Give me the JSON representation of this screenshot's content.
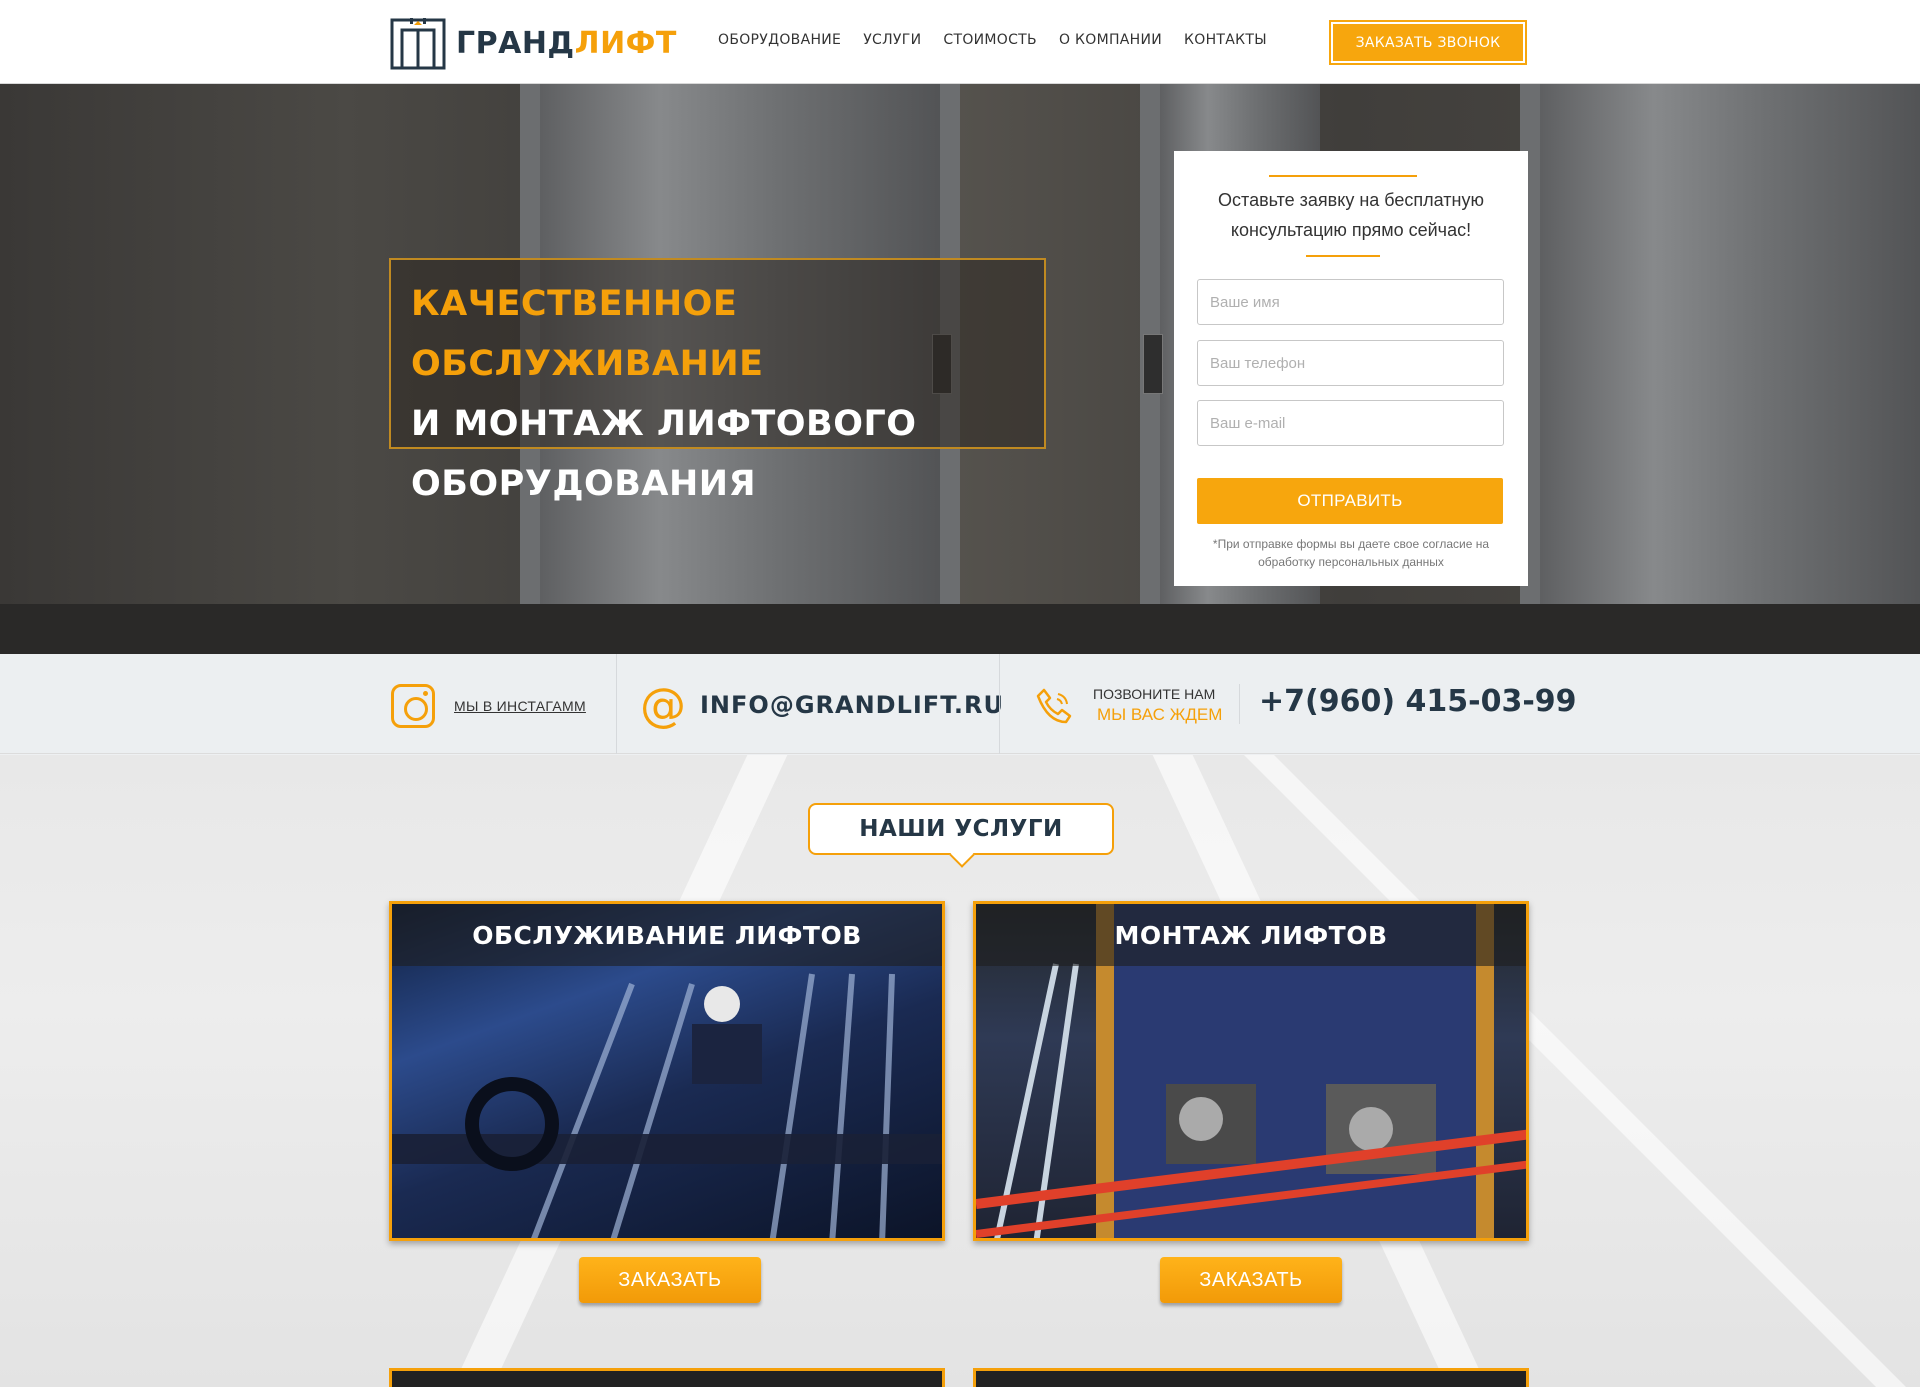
{
  "header": {
    "logo_part1": "ГРАНД",
    "logo_part2": "ЛИФТ",
    "nav": [
      "ОБОРУДОВАНИЕ",
      "УСЛУГИ",
      "СТОИМОСТЬ",
      "О КОМПАНИИ",
      "КОНТАКТЫ"
    ],
    "call_button": "ЗАКАЗАТЬ ЗВОНОК"
  },
  "hero": {
    "line1": "КАЧЕСТВЕННОЕ ОБСЛУЖИВАНИЕ",
    "line2": "И МОНТАЖ ЛИФТОВОГО",
    "line3": "ОБОРУДОВАНИЯ"
  },
  "form": {
    "title": "Оставьте заявку на бесплатную консультацию прямо сейчас!",
    "name_placeholder": "Ваше имя",
    "phone_placeholder": "Ваш телефон",
    "email_placeholder": "Ваш e-mail",
    "submit": "ОТПРАВИТЬ",
    "note": "*При отправке формы вы даете свое согласие на обработку персональных данных"
  },
  "contacts": {
    "instagram": "МЫ В ИНСТАГАММ",
    "email": "INFO@GRANDLIFT.RU",
    "call_label": "ПОЗВОНИТЕ НАМ",
    "call_sub": "МЫ ВАС ЖДЕМ",
    "phone": "+7(960) 415-03-99"
  },
  "services": {
    "title": "НАШИ УСЛУГИ",
    "items": [
      {
        "title": "ОБСЛУЖИВАНИЕ ЛИФТОВ",
        "button": "ЗАКАЗАТЬ"
      },
      {
        "title": "МОНТАЖ ЛИФТОВ",
        "button": "ЗАКАЗАТЬ"
      }
    ]
  },
  "colors": {
    "accent": "#f5a00a",
    "dark": "#253746"
  }
}
